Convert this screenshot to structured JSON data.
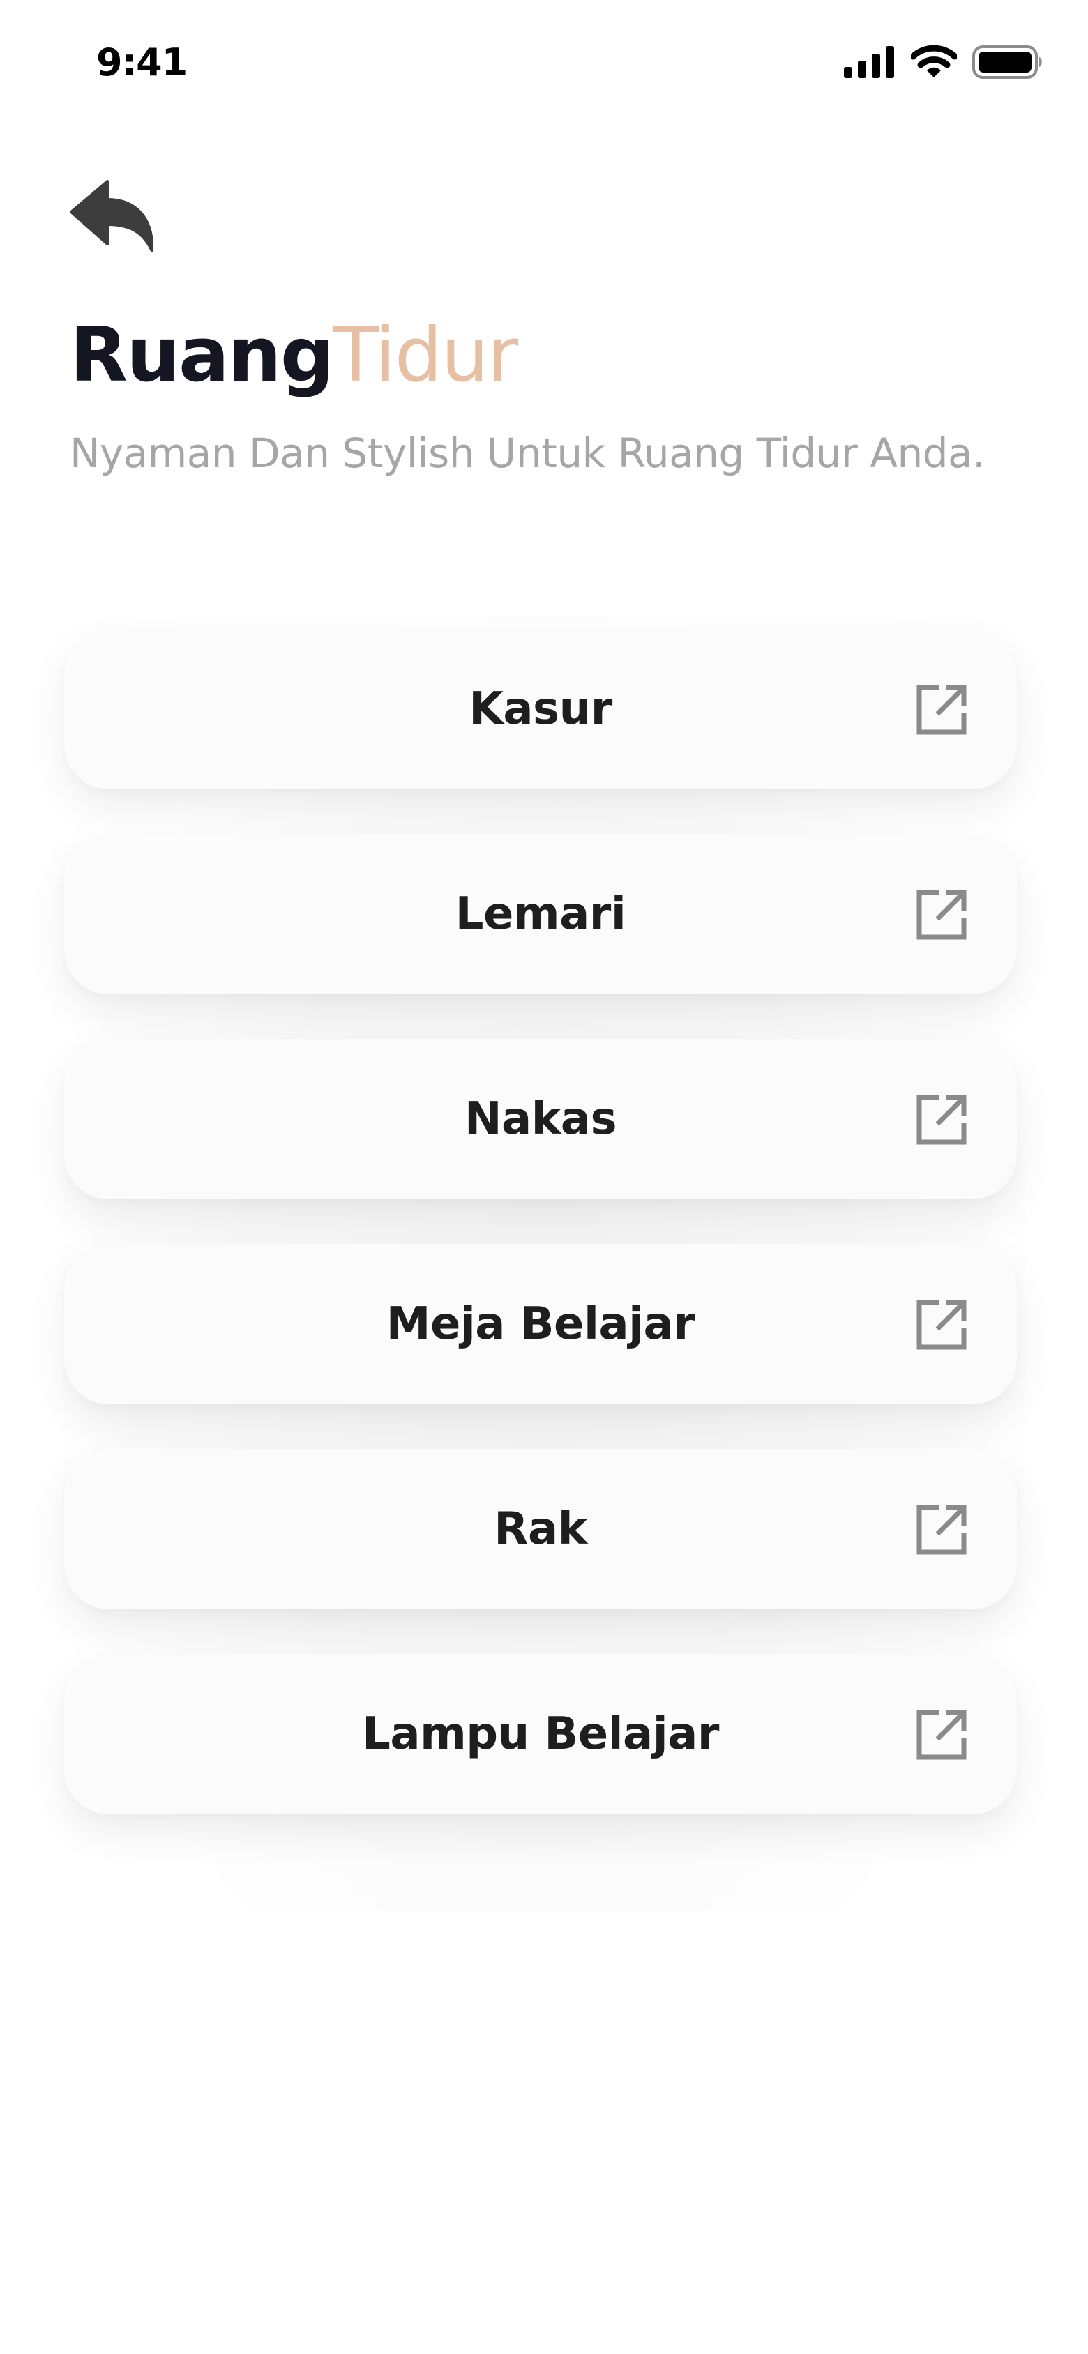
{
  "status_bar": {
    "time": "9:41",
    "icons": [
      "signal-icon",
      "wifi-icon",
      "battery-icon"
    ]
  },
  "header": {
    "back_icon": "reply-arrow-icon",
    "title_part1": "Ruang",
    "title_part2": "Tidur",
    "subtitle": "Nyaman Dan Stylish Untuk Ruang Tidur Anda."
  },
  "colors": {
    "title_dark": "#141622",
    "title_accent": "#e6bfa4",
    "subtitle": "#a6a6a6",
    "card_bg": "#fbfbfb",
    "icon": "#8a8a8a"
  },
  "items": [
    {
      "label": "Kasur",
      "icon": "external-link-icon"
    },
    {
      "label": "Lemari",
      "icon": "external-link-icon"
    },
    {
      "label": "Nakas",
      "icon": "external-link-icon"
    },
    {
      "label": "Meja Belajar",
      "icon": "external-link-icon"
    },
    {
      "label": "Rak",
      "icon": "external-link-icon"
    },
    {
      "label": "Lampu Belajar",
      "icon": "external-link-icon"
    }
  ]
}
